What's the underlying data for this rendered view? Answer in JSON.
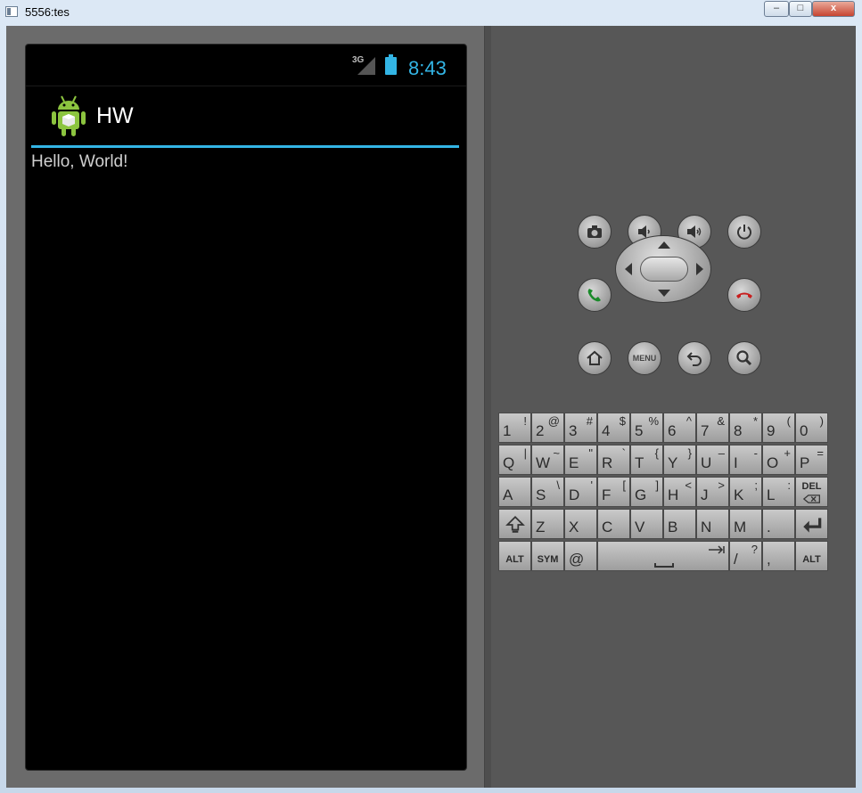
{
  "window": {
    "title": "5556:tes",
    "minimize_label": "–",
    "maximize_label": "□",
    "close_label": "x"
  },
  "statusbar": {
    "network": "3G",
    "time": "8:43"
  },
  "app": {
    "title": "HW",
    "body_text": "Hello, World!",
    "accent": "#33b5e5"
  },
  "controls": {
    "menu_label": "MENU"
  },
  "keyboard": {
    "rows": [
      [
        {
          "m": "1",
          "s": "!"
        },
        {
          "m": "2",
          "s": "@"
        },
        {
          "m": "3",
          "s": "#"
        },
        {
          "m": "4",
          "s": "$"
        },
        {
          "m": "5",
          "s": "%"
        },
        {
          "m": "6",
          "s": "^"
        },
        {
          "m": "7",
          "s": "&"
        },
        {
          "m": "8",
          "s": "*"
        },
        {
          "m": "9",
          "s": "("
        },
        {
          "m": "0",
          "s": ")"
        }
      ],
      [
        {
          "m": "Q",
          "s": "|"
        },
        {
          "m": "W",
          "s": "~"
        },
        {
          "m": "E",
          "s": "\""
        },
        {
          "m": "R",
          "s": "`"
        },
        {
          "m": "T",
          "s": "{"
        },
        {
          "m": "Y",
          "s": "}"
        },
        {
          "m": "U",
          "s": "–"
        },
        {
          "m": "I",
          "s": "-"
        },
        {
          "m": "O",
          "s": "+"
        },
        {
          "m": "P",
          "s": "="
        }
      ],
      [
        {
          "m": "A",
          "s": ""
        },
        {
          "m": "S",
          "s": "\\"
        },
        {
          "m": "D",
          "s": "'"
        },
        {
          "m": "F",
          "s": "["
        },
        {
          "m": "G",
          "s": "]"
        },
        {
          "m": "H",
          "s": "<"
        },
        {
          "m": "J",
          "s": ">"
        },
        {
          "m": "K",
          "s": ";"
        },
        {
          "m": "L",
          "s": ":"
        }
      ],
      [
        {
          "m": "Z",
          "s": ""
        },
        {
          "m": "X",
          "s": ""
        },
        {
          "m": "C",
          "s": ""
        },
        {
          "m": "V",
          "s": ""
        },
        {
          "m": "B",
          "s": ""
        },
        {
          "m": "N",
          "s": ""
        },
        {
          "m": "M",
          "s": ""
        },
        {
          "m": ".",
          "s": ""
        }
      ]
    ],
    "del_label": "DEL",
    "alt_label": "ALT",
    "sym_label": "SYM",
    "at_label": "@",
    "slash_label": "/",
    "slash_sup": "?",
    "comma_label": ","
  }
}
